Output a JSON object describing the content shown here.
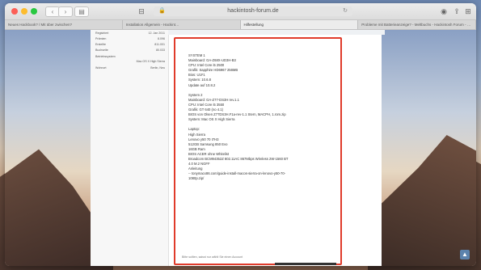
{
  "browser": {
    "url": "hackintosh-forum.de",
    "tabs": [
      "Neues Hackbook? / Mit über zwischen?",
      "Installation Allgemein - Hackint…",
      "Hilfestellung",
      "Probleme mit Batterieanzeige? - Meltbuchs - Hackintosh Forum - Forum"
    ]
  },
  "sidebar": {
    "info": [
      {
        "label": "Registriert",
        "value": "12. Jan 2011"
      },
      {
        "label": "Prämien",
        "value": "8.096"
      },
      {
        "label": "Erstellte",
        "value": "811.001"
      },
      {
        "label": "Buchseite",
        "value": "80.033"
      },
      {
        "label": "Betriebssystem",
        "value": "Mac OS X High Sierra"
      },
      {
        "label": "Wohnort",
        "value": "Berlin, Neu"
      }
    ]
  },
  "post": {
    "lines": [
      "SYSTEM 1",
      "Mainboard: GA-Z68X-UD3H-B3",
      "CPU: Intel Core i5 2500",
      "Grafik: Sapphire HD6967 256MB",
      "Bios: U1F1",
      "System: 10.6.8",
      "Update auf 10.8.2",
      "",
      "System 2",
      "Mainboard: GA-Z77-DS3H rev.1.1",
      "CPU: Intel Core i5 3550",
      "Grafik: GT 640 (no 4.1)",
      "BIOS von Olsen Z77DS3H.F1a-rev-1.1 Stern, MACPH, 1.rom.zip",
      "System: Mac OS X High Sierra",
      "",
      "Laptop:",
      "High Sierra",
      "Lenovo y50 70 I7H3",
      "512GB Samsung 850 Evo",
      "16GB Ram",
      "BIOS ACER ohne Whitelist",
      "Broadcom BCM94352Z 802.11AC 867Mbps Wireless 2W-1560 BT",
      "4.0 M.2 NGFF",
      "Anleitung",
      "-- tonymacx86.com/guide-install-macos-sierra-on-lenovo-y50-70-",
      "1080p.zip/"
    ],
    "footer": "Bitte sollten, saisst nur wählt Sie einen Account"
  }
}
